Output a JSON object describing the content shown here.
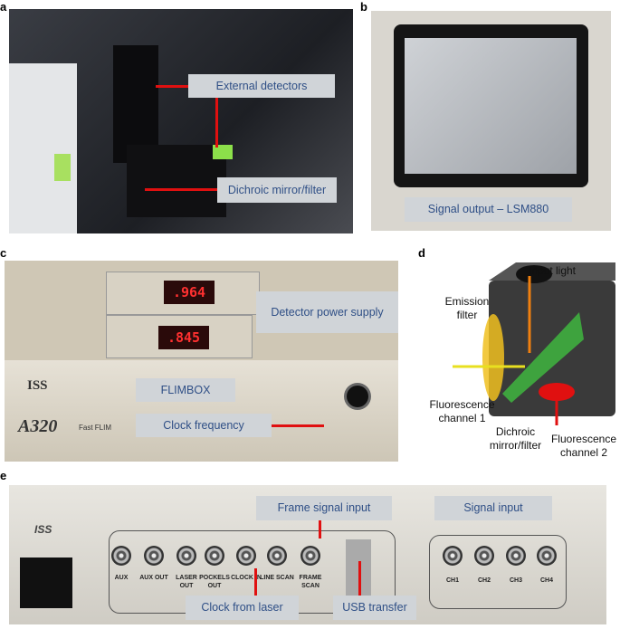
{
  "panels": {
    "a": {
      "letter": "a",
      "labels": {
        "external_detectors": "External detectors",
        "dichroic": "Dichroic mirror/filter"
      }
    },
    "b": {
      "letter": "b",
      "labels": {
        "signal_output": "Signal output – LSM880"
      }
    },
    "c": {
      "letter": "c",
      "labels": {
        "detector_power": "Detector power supply",
        "flimbox": "FLIMBOX",
        "clock_frequency": "Clock frequency"
      },
      "displays": [
        ".964",
        ".845"
      ],
      "brand": "ISS",
      "model": "A320",
      "model_sub": "Fast FLIM"
    },
    "d": {
      "letter": "d",
      "labels": {
        "input_light": "Input light",
        "emission_filter": "Emission filter",
        "fluor1": "Fluorescence channel 1",
        "dichroic": "Dichroic mirror/filter",
        "fluor2": "Fluorescence channel 2"
      }
    },
    "e": {
      "letter": "e",
      "labels": {
        "frame_signal": "Frame signal input",
        "signal_input": "Signal input",
        "clock_laser": "Clock from laser",
        "usb": "USB transfer"
      },
      "brand": "ISS",
      "connectors": [
        "AUX",
        "AUX OUT",
        "LASER OUT",
        "POCKELS OUT",
        "CLOCK IN",
        "LINE SCAN",
        "FRAME SCAN"
      ],
      "channels": [
        "CH1",
        "CH2",
        "CH3",
        "CH4"
      ]
    }
  },
  "colors": {
    "label_bg": "#d0d4d8",
    "label_text": "#2f4f86",
    "arrow": "#e01010"
  }
}
